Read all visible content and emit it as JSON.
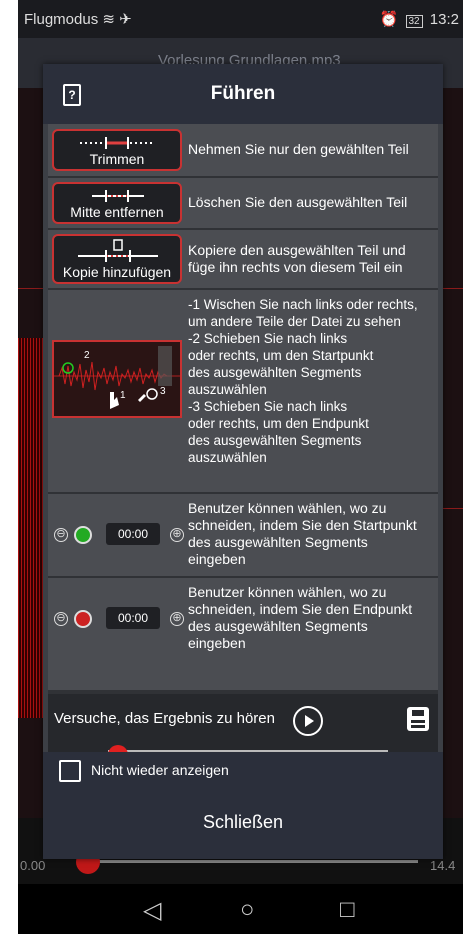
{
  "status": {
    "left": "Flugmodus",
    "battery": "32",
    "time": "13:2"
  },
  "background": {
    "filename": "Vorlesung Grundlagen.mp3",
    "time_start": "0.00",
    "time_end": "14.4"
  },
  "dialog": {
    "title": "Führen",
    "rows": [
      {
        "button": "Trimmen",
        "lines": [
          "Nehmen Sie nur den gewählten Teil"
        ]
      },
      {
        "button": "Mitte entfernen",
        "lines": [
          "Löschen Sie den ausgewählten Teil"
        ]
      },
      {
        "button": "Kopie hinzufügen",
        "lines": [
          "Kopiere den ausgewählten Teil und",
          "füge ihn rechts von diesem Teil ein"
        ]
      }
    ],
    "swipe": {
      "lines": [
        "-1 Wischen Sie nach links oder rechts,",
        "um andere Teile der Datei zu sehen",
        "-2 Schieben Sie nach links",
        "oder rechts, um den Startpunkt",
        "des ausgewählten Segments",
        "auszuwählen",
        "-3 Schieben Sie nach links",
        "oder rechts, um den Endpunkt",
        "des ausgewählten Segments",
        "auszuwählen"
      ],
      "marks": [
        "2",
        "1",
        "3"
      ]
    },
    "time_rows": [
      {
        "time": "00:00",
        "minus": "⊖",
        "plus": "⊕",
        "lines": [
          "Benutzer können wählen, wo zu",
          "schneiden, indem Sie den Startpunkt",
          "des ausgewählten Segments",
          "eingeben"
        ]
      },
      {
        "time": "00:00",
        "minus": "⊖",
        "plus": "⊕",
        "lines": [
          "Benutzer können wählen, wo zu",
          "schneiden, indem Sie den Endpunkt",
          "des ausgewählten Segments",
          "eingeben"
        ]
      }
    ],
    "listen": {
      "label": "Versuche, das Ergebnis zu hören"
    },
    "checkbox_label": "Nicht wieder anzeigen",
    "close": "Schließen"
  },
  "colors": {
    "accent": "#c83232",
    "dialog_header": "#2b2f3b",
    "row_bg": "#4b4d52"
  },
  "icons": [
    "airplane-icon",
    "wifi-icon",
    "help-icon",
    "play-icon",
    "save-icon",
    "back-icon",
    "home-icon",
    "recents-icon"
  ]
}
